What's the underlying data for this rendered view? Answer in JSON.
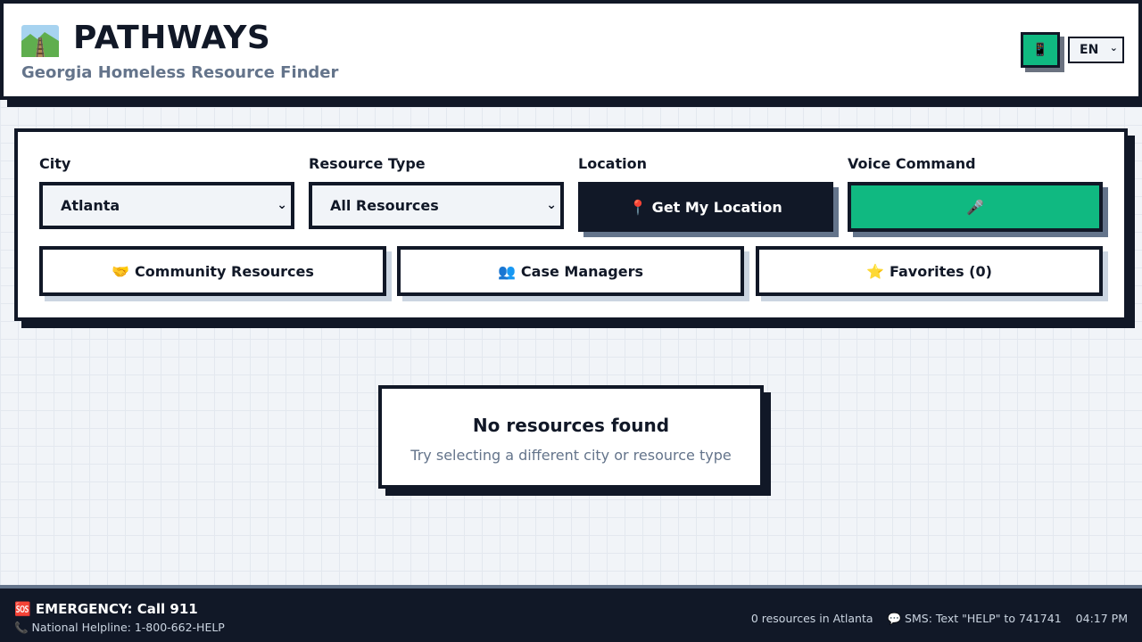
{
  "header": {
    "logo_icon": "railway-track-icon",
    "title": "PATHWAYS",
    "subtitle": "Georgia Homeless Resource Finder",
    "phone_button_icon": "📱",
    "language_selected": "EN"
  },
  "filters": {
    "city_label": "City",
    "city_value": "Atlanta",
    "resource_type_label": "Resource Type",
    "resource_type_value": "All Resources",
    "location_label": "Location",
    "location_button": "📍 Get My Location",
    "voice_label": "Voice Command",
    "voice_button_icon": "🎤"
  },
  "actions": {
    "community_icon": "🤝",
    "community_label": "Community Resources",
    "case_managers_icon": "👥",
    "case_managers_label": "Case Managers",
    "favorites_icon": "⭐",
    "favorites_label": "Favorites (0)"
  },
  "empty_state": {
    "title": "No resources found",
    "message": "Try selecting a different city or resource type"
  },
  "footer": {
    "emergency": "🆘 EMERGENCY: Call 911",
    "helpline": "📞 National Helpline: 1-800-662-HELP",
    "resource_count": "0 resources in Atlanta",
    "sms": "💬 SMS: Text \"HELP\" to 741741",
    "time": "04:17 PM"
  },
  "colors": {
    "primary_dark": "#111827",
    "accent_green": "#10b981",
    "muted_text": "#64748b"
  }
}
